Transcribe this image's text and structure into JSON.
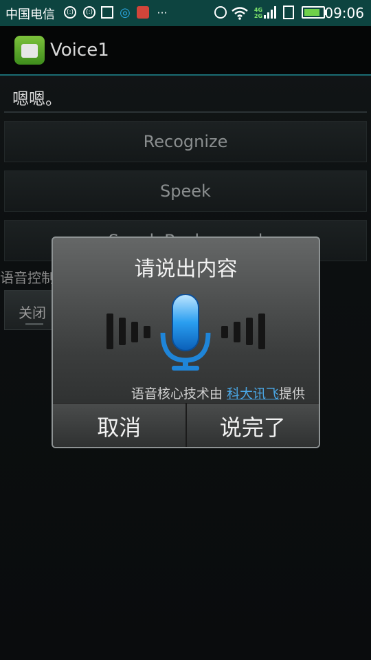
{
  "statusbar": {
    "carrier": "中国电信",
    "time": "09:06",
    "network_top": "4G",
    "network_bottom": "2G"
  },
  "actionbar": {
    "app_title": "Voice1"
  },
  "main": {
    "text_field_value": "嗯嗯。",
    "buttons": [
      {
        "label": "Recognize"
      },
      {
        "label": "Speek"
      },
      {
        "label": "Speek Background"
      }
    ],
    "switch_label": "语音控制开关",
    "toggle_label": "关闭"
  },
  "dialog": {
    "title": "请说出内容",
    "credit_prefix": "语音核心技术由 ",
    "credit_link": "科大讯飞",
    "credit_suffix": "提供",
    "cancel_label": "取消",
    "done_label": "说完了"
  },
  "colors": {
    "statusbar": "#0d4440",
    "accent_line": "#1a6c73",
    "link": "#4aa6e4",
    "mic_blue": "#1e90e8"
  }
}
